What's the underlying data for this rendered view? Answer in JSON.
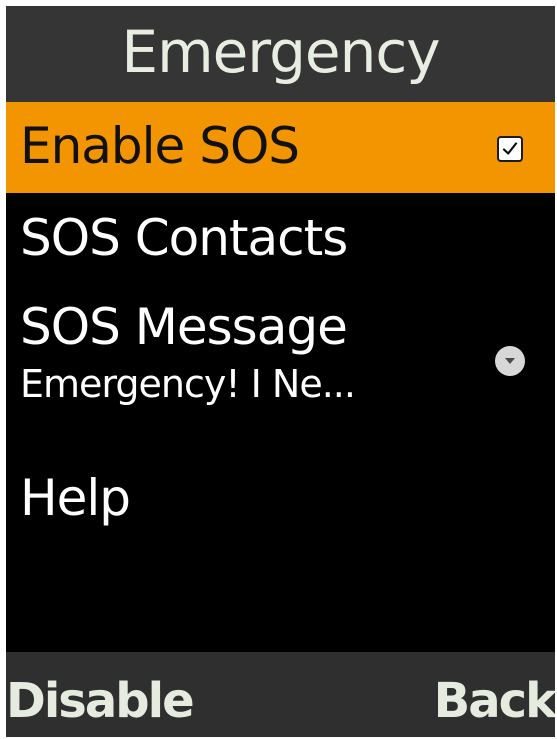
{
  "header": {
    "title": "Emergency"
  },
  "menu": {
    "items": [
      {
        "label": "Enable SOS",
        "control": "checkbox",
        "checked": true,
        "selected": true,
        "icon": "checkmark-icon"
      },
      {
        "label": "SOS Contacts"
      },
      {
        "label": "SOS Message",
        "value": "Emergency! I Ne...",
        "control": "dropdown",
        "icon": "chevron-down-icon"
      },
      {
        "label": "Help"
      }
    ]
  },
  "softkeys": {
    "left": "Disable",
    "right": "Back"
  },
  "colors": {
    "selection": "#f39401",
    "header_bg": "#353535",
    "softkey_bg": "#2f2f2f",
    "screen_bg": "#000000"
  }
}
